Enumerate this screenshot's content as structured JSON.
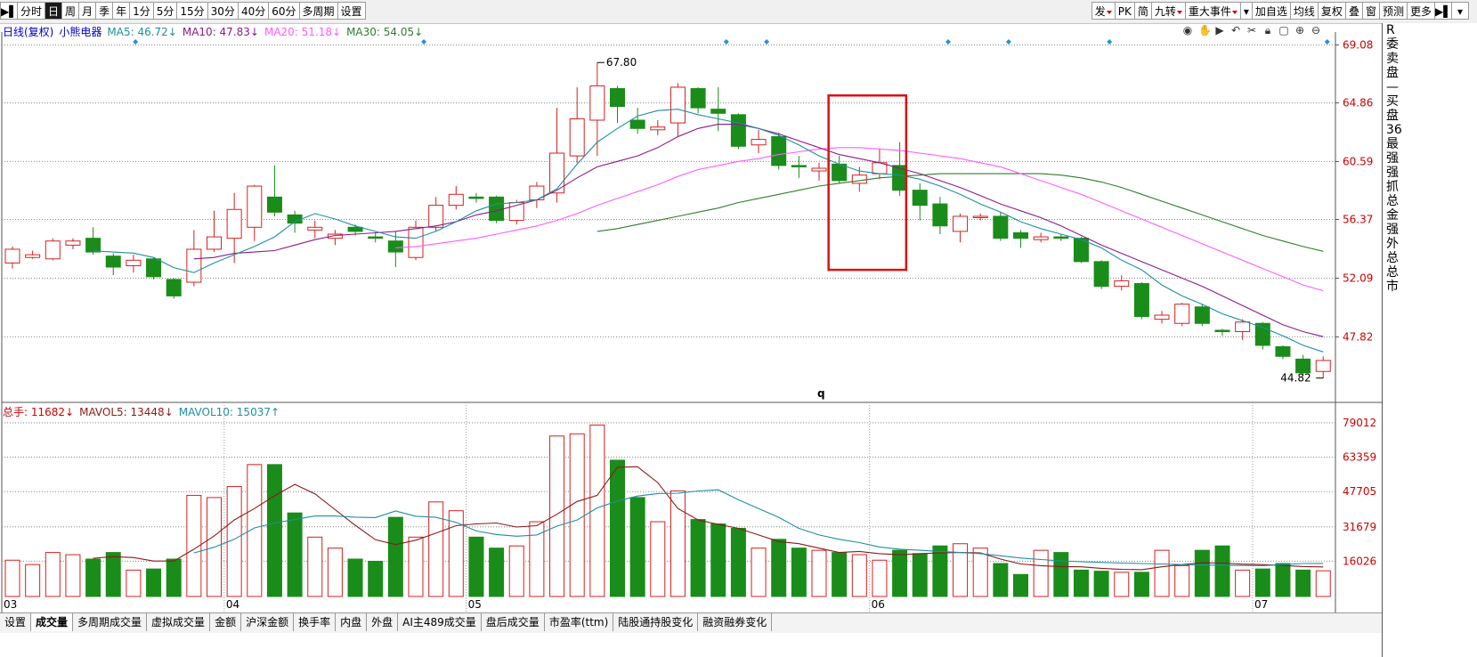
{
  "toolbar": {
    "left": [
      "分时",
      "日",
      "周",
      "月",
      "季",
      "年",
      "1分",
      "5分",
      "15分",
      "30分",
      "40分",
      "60分",
      "多周期",
      "设置"
    ],
    "selected": "日",
    "right": [
      "发",
      "PK",
      "简",
      "九转",
      "重大事件",
      "加自选",
      "均线",
      "复权",
      "叠",
      "窗",
      "预测",
      "更多"
    ]
  },
  "legend": {
    "main": [
      {
        "text": "日线(复权)",
        "color": "#0000c8"
      },
      {
        "text": "小熊电器",
        "color": "#0000c8"
      },
      {
        "text": "MA5: 46.72↓",
        "color": "#1e8fa0"
      },
      {
        "text": "MA10: 47.83↓",
        "color": "#8b1a8b"
      },
      {
        "text": "MA20: 51.18↓",
        "color": "#ff5cff"
      },
      {
        "text": "MA30: 54.05↓",
        "color": "#2e7d2e"
      }
    ],
    "volume": [
      {
        "text": "总手: 11682↓",
        "color": "#cc0000"
      },
      {
        "text": "MAVOL5: 13448↓",
        "color": "#8b1a1a"
      },
      {
        "text": "MAVOL10: 15037↑",
        "color": "#1e8fa0"
      }
    ]
  },
  "chart_data": [
    {
      "type": "candlestick",
      "title": "",
      "ylim": [
        43.5,
        69.5
      ],
      "y_ticks": [
        69.08,
        64.86,
        60.59,
        56.37,
        52.09,
        47.82
      ],
      "x_labels": [
        "03",
        "04",
        "05",
        "06",
        "07"
      ],
      "annotations": {
        "high": "67.80",
        "low": "44.82",
        "marker": "q"
      },
      "candles": [
        [
          53.2,
          54.2,
          52.8,
          54.4
        ],
        [
          53.6,
          53.8,
          53.5,
          54.1
        ],
        [
          53.5,
          54.8,
          53.4,
          55.0
        ],
        [
          54.5,
          54.8,
          54.2,
          55.0
        ],
        [
          55.0,
          54.0,
          53.8,
          55.8
        ],
        [
          53.7,
          52.9,
          52.3,
          53.9
        ],
        [
          53.0,
          53.4,
          52.5,
          53.8
        ],
        [
          53.5,
          52.2,
          52.0,
          53.6
        ],
        [
          52.0,
          50.8,
          50.6,
          52.1
        ],
        [
          51.8,
          54.2,
          51.5,
          55.6
        ],
        [
          54.2,
          55.1,
          54.0,
          57.0
        ],
        [
          55.0,
          57.1,
          53.2,
          58.3
        ],
        [
          55.8,
          58.8,
          54.8,
          58.9
        ],
        [
          58.0,
          56.9,
          56.6,
          60.3
        ],
        [
          56.7,
          56.1,
          55.4,
          57.0
        ],
        [
          55.6,
          55.8,
          55.0,
          56.3
        ],
        [
          55.0,
          55.3,
          54.5,
          55.6
        ],
        [
          55.8,
          55.5,
          55.2,
          56.0
        ],
        [
          55.1,
          55.0,
          54.7,
          55.4
        ],
        [
          54.8,
          54.0,
          52.9,
          55.5
        ],
        [
          53.6,
          55.8,
          53.4,
          56.3
        ],
        [
          55.8,
          57.4,
          55.5,
          58.0
        ],
        [
          57.4,
          58.2,
          57.1,
          58.8
        ],
        [
          58.0,
          57.9,
          57.6,
          58.3
        ],
        [
          58.0,
          56.3,
          56.1,
          58.1
        ],
        [
          56.3,
          57.6,
          56.0,
          57.8
        ],
        [
          57.8,
          58.8,
          57.2,
          59.1
        ],
        [
          58.3,
          61.2,
          57.6,
          64.5
        ],
        [
          61.0,
          63.7,
          60.5,
          66.0
        ],
        [
          63.6,
          66.1,
          61.0,
          67.8
        ],
        [
          65.9,
          64.6,
          63.4,
          66.1
        ],
        [
          63.6,
          63.0,
          62.6,
          64.5
        ],
        [
          62.9,
          63.1,
          62.5,
          63.6
        ],
        [
          63.4,
          66.0,
          62.4,
          66.3
        ],
        [
          65.9,
          64.5,
          64.1,
          66.0
        ],
        [
          64.4,
          64.1,
          62.8,
          66.0
        ],
        [
          64.0,
          61.7,
          61.5,
          64.1
        ],
        [
          61.8,
          62.2,
          61.2,
          62.9
        ],
        [
          62.4,
          60.3,
          60.0,
          62.7
        ],
        [
          60.3,
          60.2,
          59.4,
          61.0
        ],
        [
          59.9,
          60.1,
          59.2,
          60.5
        ],
        [
          60.4,
          59.2,
          59.0,
          61.0
        ],
        [
          59.0,
          59.6,
          58.4,
          60.2
        ],
        [
          59.7,
          60.5,
          59.3,
          61.5
        ],
        [
          60.3,
          58.5,
          58.1,
          62.0
        ],
        [
          58.5,
          57.4,
          56.3,
          59.0
        ],
        [
          57.5,
          55.9,
          55.3,
          58.0
        ],
        [
          55.5,
          56.6,
          54.7,
          56.8
        ],
        [
          56.5,
          56.6,
          56.3,
          56.8
        ],
        [
          56.6,
          55.0,
          54.8,
          56.9
        ],
        [
          55.4,
          55.0,
          54.3,
          55.6
        ],
        [
          54.9,
          55.1,
          54.7,
          55.4
        ],
        [
          55.1,
          55.0,
          54.8,
          55.3
        ],
        [
          55.0,
          53.3,
          53.2,
          55.1
        ],
        [
          53.3,
          51.5,
          51.3,
          53.4
        ],
        [
          51.5,
          51.9,
          51.2,
          52.3
        ],
        [
          51.7,
          49.3,
          49.1,
          51.8
        ],
        [
          49.1,
          49.4,
          48.8,
          49.7
        ],
        [
          48.8,
          50.2,
          48.6,
          50.3
        ],
        [
          50.0,
          48.8,
          48.6,
          50.2
        ],
        [
          48.3,
          48.2,
          47.9,
          48.4
        ],
        [
          48.2,
          48.9,
          47.6,
          49.1
        ],
        [
          48.8,
          47.2,
          46.9,
          48.9
        ],
        [
          47.1,
          46.4,
          46.2,
          47.2
        ],
        [
          46.2,
          45.2,
          45.0,
          46.5
        ],
        [
          45.3,
          46.1,
          44.8,
          46.4
        ]
      ],
      "ma5": [
        null,
        null,
        null,
        null,
        54.08,
        54.0,
        53.92,
        53.6,
        52.86,
        52.5,
        53.2,
        53.8,
        54.4,
        55.1,
        56.2,
        56.8,
        56.4,
        55.9,
        55.5,
        55.1,
        55.0,
        55.5,
        56.2,
        57.0,
        57.5,
        57.6,
        57.8,
        58.6,
        60.4,
        62.0,
        63.0,
        63.9,
        64.3,
        64.4,
        64.0,
        63.7,
        63.4,
        63.0,
        62.5,
        61.8,
        61.0,
        60.4,
        59.9,
        59.7,
        59.6,
        59.3,
        58.8,
        58.2,
        57.5,
        56.9,
        56.2,
        55.7,
        55.3,
        54.9,
        54.3,
        53.4,
        52.7,
        51.6,
        50.8,
        50.2,
        49.5,
        49.0,
        48.5,
        47.9,
        47.2,
        46.72
      ],
      "ma10": [
        null,
        null,
        null,
        null,
        null,
        null,
        null,
        null,
        null,
        53.5,
        53.6,
        53.9,
        54.0,
        54.1,
        54.5,
        54.9,
        55.2,
        55.3,
        55.4,
        55.5,
        55.7,
        55.9,
        56.2,
        56.7,
        57.0,
        57.4,
        57.8,
        58.5,
        59.4,
        60.2,
        60.6,
        61.0,
        61.6,
        62.4,
        63.0,
        63.3,
        63.3,
        63.0,
        62.6,
        62.1,
        61.6,
        61.1,
        60.8,
        60.5,
        60.1,
        59.7,
        59.2,
        58.7,
        58.1,
        57.5,
        57.0,
        56.5,
        55.9,
        55.2,
        54.5,
        53.9,
        53.3,
        52.7,
        52.1,
        51.5,
        50.8,
        50.1,
        49.4,
        48.7,
        48.2,
        47.83
      ],
      "ma20": [
        null,
        null,
        null,
        null,
        null,
        null,
        null,
        null,
        null,
        null,
        null,
        null,
        null,
        null,
        null,
        null,
        null,
        null,
        null,
        54.3,
        54.4,
        54.6,
        54.8,
        55.0,
        55.3,
        55.6,
        55.9,
        56.3,
        56.8,
        57.4,
        57.9,
        58.4,
        58.9,
        59.5,
        60.0,
        60.3,
        60.6,
        60.8,
        61.1,
        61.3,
        61.5,
        61.6,
        61.6,
        61.5,
        61.4,
        61.2,
        61.0,
        60.8,
        60.5,
        60.2,
        59.7,
        59.2,
        58.7,
        58.2,
        57.6,
        57.0,
        56.4,
        55.8,
        55.2,
        54.6,
        54.0,
        53.4,
        52.8,
        52.2,
        51.6,
        51.18
      ],
      "ma30": [
        null,
        null,
        null,
        null,
        null,
        null,
        null,
        null,
        null,
        null,
        null,
        null,
        null,
        null,
        null,
        null,
        null,
        null,
        null,
        null,
        null,
        null,
        null,
        null,
        null,
        null,
        null,
        null,
        null,
        55.5,
        55.7,
        56.0,
        56.3,
        56.6,
        56.9,
        57.2,
        57.6,
        57.9,
        58.2,
        58.5,
        58.8,
        59.0,
        59.2,
        59.4,
        59.5,
        59.6,
        59.7,
        59.7,
        59.7,
        59.7,
        59.7,
        59.7,
        59.6,
        59.4,
        59.1,
        58.7,
        58.2,
        57.7,
        57.2,
        56.7,
        56.2,
        55.7,
        55.2,
        54.8,
        54.4,
        54.05
      ]
    },
    {
      "type": "bar",
      "title": "",
      "ylim": [
        0,
        81000
      ],
      "y_ticks": [
        79012,
        63359,
        47705,
        31679,
        16026
      ],
      "volume": [
        16500,
        14500,
        20000,
        19000,
        17000,
        20000,
        12000,
        12500,
        17000,
        46000,
        45000,
        50000,
        60000,
        60000,
        38000,
        27000,
        22000,
        17000,
        16000,
        36000,
        27000,
        43000,
        39000,
        27000,
        22000,
        23000,
        34000,
        73000,
        74000,
        78000,
        62000,
        45000,
        34000,
        48000,
        35000,
        33000,
        31000,
        22000,
        26000,
        22000,
        21000,
        20000,
        19000,
        16500,
        21000,
        19500,
        23000,
        24000,
        22000,
        15000,
        10000,
        21000,
        20000,
        12000,
        11500,
        11000,
        11000,
        21000,
        14000,
        21000,
        23000,
        12000,
        12500,
        15000,
        12000,
        11682
      ],
      "mavol5": [
        null,
        null,
        null,
        null,
        17400,
        18100,
        17700,
        16100,
        16100,
        21500,
        27500,
        34800,
        40000,
        45800,
        51000,
        46700,
        39500,
        32400,
        25800,
        23600,
        25600,
        28800,
        32200,
        33000,
        33400,
        31600,
        32200,
        37400,
        43200,
        46000,
        58800,
        59000,
        51800,
        40000,
        34800,
        32800,
        31000,
        28000,
        25000,
        24000,
        22000,
        20000,
        20500,
        19500,
        19000,
        19500,
        19800,
        20000,
        19800,
        17000,
        14800,
        14000,
        13600,
        13500,
        12800,
        12300,
        12200,
        13500,
        14600,
        15300,
        15200,
        14700,
        14500,
        14100,
        13600,
        13448
      ],
      "mavol10": [
        null,
        null,
        null,
        null,
        null,
        null,
        null,
        null,
        null,
        19800,
        22400,
        26000,
        31200,
        33400,
        35000,
        36600,
        36600,
        36100,
        35900,
        38900,
        36500,
        36000,
        33700,
        29800,
        28200,
        27400,
        28000,
        32000,
        34800,
        40300,
        43400,
        45700,
        46800,
        47000,
        48000,
        48500,
        44000,
        40000,
        36000,
        31000,
        28000,
        26000,
        24500,
        22500,
        21500,
        21000,
        20500,
        20000,
        19500,
        18500,
        17500,
        16800,
        16200,
        15800,
        15500,
        15200,
        15000,
        14800,
        14500,
        14300,
        14200,
        14100,
        14000,
        14500,
        15000,
        15037
      ]
    }
  ],
  "tabs": [
    "设置",
    "成交量",
    "多周期成交量",
    "虚拟成交量",
    "金额",
    "沪深金额",
    "换手率",
    "内盘",
    "外盘",
    "AI主489成交量",
    "盘后成交量",
    "市盈率(ttm)",
    "陆股通持股变化",
    "融资融券变化"
  ],
  "selected_tab": "成交量",
  "side_text": [
    "R",
    "委",
    "卖",
    "盘",
    "—",
    "买",
    "盘",
    "36",
    "最",
    "强",
    "强",
    "抓",
    "总",
    "金",
    "强",
    "外",
    "总",
    "总",
    "市"
  ]
}
